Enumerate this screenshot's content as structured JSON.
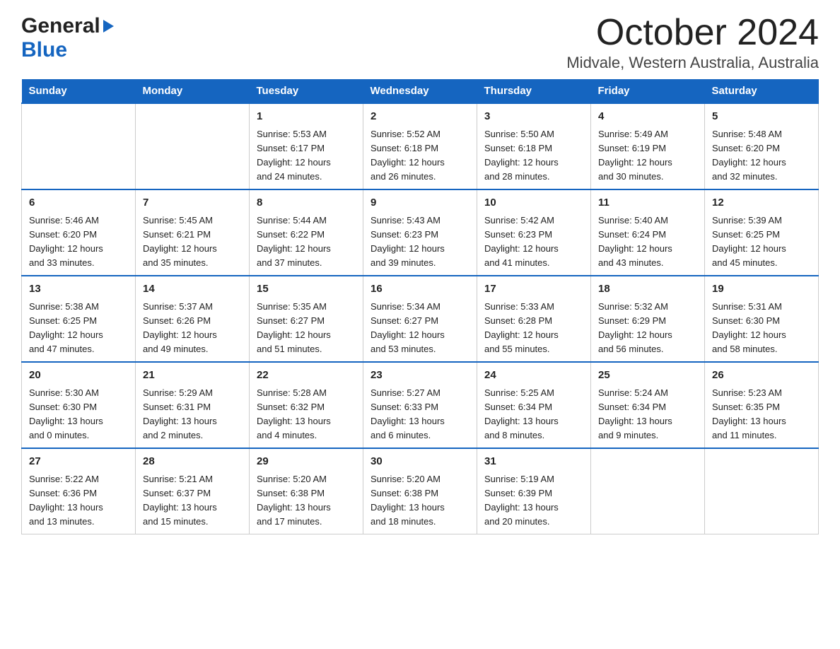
{
  "header": {
    "logo_line1": "General",
    "logo_arrow": "▶",
    "logo_line2": "Blue",
    "month_title": "October 2024",
    "location": "Midvale, Western Australia, Australia"
  },
  "days_of_week": [
    "Sunday",
    "Monday",
    "Tuesday",
    "Wednesday",
    "Thursday",
    "Friday",
    "Saturday"
  ],
  "weeks": [
    [
      {
        "day": "",
        "info": ""
      },
      {
        "day": "",
        "info": ""
      },
      {
        "day": "1",
        "info": "Sunrise: 5:53 AM\nSunset: 6:17 PM\nDaylight: 12 hours\nand 24 minutes."
      },
      {
        "day": "2",
        "info": "Sunrise: 5:52 AM\nSunset: 6:18 PM\nDaylight: 12 hours\nand 26 minutes."
      },
      {
        "day": "3",
        "info": "Sunrise: 5:50 AM\nSunset: 6:18 PM\nDaylight: 12 hours\nand 28 minutes."
      },
      {
        "day": "4",
        "info": "Sunrise: 5:49 AM\nSunset: 6:19 PM\nDaylight: 12 hours\nand 30 minutes."
      },
      {
        "day": "5",
        "info": "Sunrise: 5:48 AM\nSunset: 6:20 PM\nDaylight: 12 hours\nand 32 minutes."
      }
    ],
    [
      {
        "day": "6",
        "info": "Sunrise: 5:46 AM\nSunset: 6:20 PM\nDaylight: 12 hours\nand 33 minutes."
      },
      {
        "day": "7",
        "info": "Sunrise: 5:45 AM\nSunset: 6:21 PM\nDaylight: 12 hours\nand 35 minutes."
      },
      {
        "day": "8",
        "info": "Sunrise: 5:44 AM\nSunset: 6:22 PM\nDaylight: 12 hours\nand 37 minutes."
      },
      {
        "day": "9",
        "info": "Sunrise: 5:43 AM\nSunset: 6:23 PM\nDaylight: 12 hours\nand 39 minutes."
      },
      {
        "day": "10",
        "info": "Sunrise: 5:42 AM\nSunset: 6:23 PM\nDaylight: 12 hours\nand 41 minutes."
      },
      {
        "day": "11",
        "info": "Sunrise: 5:40 AM\nSunset: 6:24 PM\nDaylight: 12 hours\nand 43 minutes."
      },
      {
        "day": "12",
        "info": "Sunrise: 5:39 AM\nSunset: 6:25 PM\nDaylight: 12 hours\nand 45 minutes."
      }
    ],
    [
      {
        "day": "13",
        "info": "Sunrise: 5:38 AM\nSunset: 6:25 PM\nDaylight: 12 hours\nand 47 minutes."
      },
      {
        "day": "14",
        "info": "Sunrise: 5:37 AM\nSunset: 6:26 PM\nDaylight: 12 hours\nand 49 minutes."
      },
      {
        "day": "15",
        "info": "Sunrise: 5:35 AM\nSunset: 6:27 PM\nDaylight: 12 hours\nand 51 minutes."
      },
      {
        "day": "16",
        "info": "Sunrise: 5:34 AM\nSunset: 6:27 PM\nDaylight: 12 hours\nand 53 minutes."
      },
      {
        "day": "17",
        "info": "Sunrise: 5:33 AM\nSunset: 6:28 PM\nDaylight: 12 hours\nand 55 minutes."
      },
      {
        "day": "18",
        "info": "Sunrise: 5:32 AM\nSunset: 6:29 PM\nDaylight: 12 hours\nand 56 minutes."
      },
      {
        "day": "19",
        "info": "Sunrise: 5:31 AM\nSunset: 6:30 PM\nDaylight: 12 hours\nand 58 minutes."
      }
    ],
    [
      {
        "day": "20",
        "info": "Sunrise: 5:30 AM\nSunset: 6:30 PM\nDaylight: 13 hours\nand 0 minutes."
      },
      {
        "day": "21",
        "info": "Sunrise: 5:29 AM\nSunset: 6:31 PM\nDaylight: 13 hours\nand 2 minutes."
      },
      {
        "day": "22",
        "info": "Sunrise: 5:28 AM\nSunset: 6:32 PM\nDaylight: 13 hours\nand 4 minutes."
      },
      {
        "day": "23",
        "info": "Sunrise: 5:27 AM\nSunset: 6:33 PM\nDaylight: 13 hours\nand 6 minutes."
      },
      {
        "day": "24",
        "info": "Sunrise: 5:25 AM\nSunset: 6:34 PM\nDaylight: 13 hours\nand 8 minutes."
      },
      {
        "day": "25",
        "info": "Sunrise: 5:24 AM\nSunset: 6:34 PM\nDaylight: 13 hours\nand 9 minutes."
      },
      {
        "day": "26",
        "info": "Sunrise: 5:23 AM\nSunset: 6:35 PM\nDaylight: 13 hours\nand 11 minutes."
      }
    ],
    [
      {
        "day": "27",
        "info": "Sunrise: 5:22 AM\nSunset: 6:36 PM\nDaylight: 13 hours\nand 13 minutes."
      },
      {
        "day": "28",
        "info": "Sunrise: 5:21 AM\nSunset: 6:37 PM\nDaylight: 13 hours\nand 15 minutes."
      },
      {
        "day": "29",
        "info": "Sunrise: 5:20 AM\nSunset: 6:38 PM\nDaylight: 13 hours\nand 17 minutes."
      },
      {
        "day": "30",
        "info": "Sunrise: 5:20 AM\nSunset: 6:38 PM\nDaylight: 13 hours\nand 18 minutes."
      },
      {
        "day": "31",
        "info": "Sunrise: 5:19 AM\nSunset: 6:39 PM\nDaylight: 13 hours\nand 20 minutes."
      },
      {
        "day": "",
        "info": ""
      },
      {
        "day": "",
        "info": ""
      }
    ]
  ]
}
